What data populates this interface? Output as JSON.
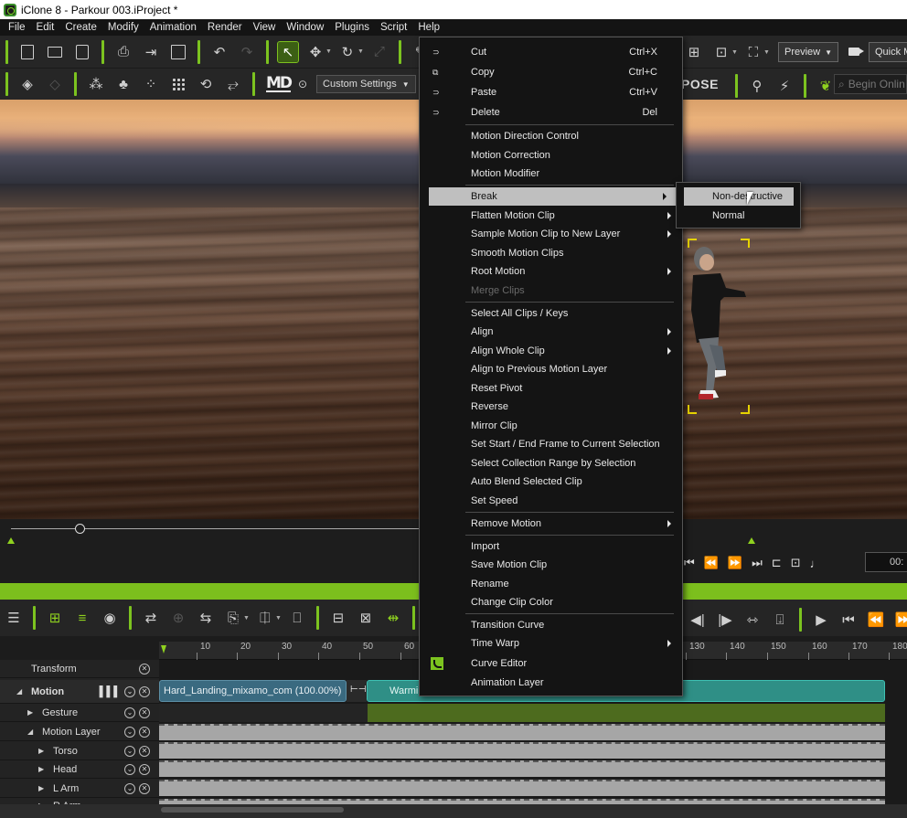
{
  "window": {
    "title": "iClone 8 - Parkour 003.iProject *"
  },
  "menubar": [
    "File",
    "Edit",
    "Create",
    "Modify",
    "Animation",
    "Render",
    "View",
    "Window",
    "Plugins",
    "Script",
    "Help"
  ],
  "toolbar": {
    "preview_label": "Preview",
    "quick_label": "Quick M",
    "custom_settings_label": "Custom Settings",
    "pose_label": "POSE",
    "search_placeholder": "Begin Onlin"
  },
  "context_menu": {
    "items": [
      {
        "label": "Cut",
        "shortcut": "Ctrl+X"
      },
      {
        "label": "Copy",
        "shortcut": "Ctrl+C"
      },
      {
        "label": "Paste",
        "shortcut": "Ctrl+V"
      },
      {
        "label": "Delete",
        "shortcut": "Del"
      },
      {
        "label": "Motion Direction Control"
      },
      {
        "label": "Motion Correction"
      },
      {
        "label": "Motion Modifier"
      },
      {
        "label": "Break"
      },
      {
        "label": "Flatten Motion Clip"
      },
      {
        "label": "Sample Motion Clip to New Layer"
      },
      {
        "label": "Smooth Motion Clips"
      },
      {
        "label": "Root Motion"
      },
      {
        "label": "Merge Clips"
      },
      {
        "label": "Select All Clips / Keys"
      },
      {
        "label": "Align"
      },
      {
        "label": "Align Whole Clip"
      },
      {
        "label": "Align to Previous Motion Layer"
      },
      {
        "label": "Reset Pivot"
      },
      {
        "label": "Reverse"
      },
      {
        "label": "Mirror Clip"
      },
      {
        "label": "Set Start / End Frame to Current Selection"
      },
      {
        "label": "Select Collection Range by Selection"
      },
      {
        "label": "Auto Blend Selected Clip"
      },
      {
        "label": "Set Speed"
      },
      {
        "label": "Remove Motion"
      },
      {
        "label": "Import"
      },
      {
        "label": "Save Motion Clip"
      },
      {
        "label": "Rename"
      },
      {
        "label": "Change Clip Color"
      },
      {
        "label": "Transition Curve"
      },
      {
        "label": "Time Warp"
      },
      {
        "label": "Curve Editor"
      },
      {
        "label": "Animation Layer"
      }
    ]
  },
  "submenu": {
    "items": [
      {
        "label": "Non-destructive"
      },
      {
        "label": "Normal"
      }
    ]
  },
  "timeline": {
    "ruler_ticks": [
      "10",
      "20",
      "30",
      "40",
      "50",
      "60",
      "130",
      "140",
      "150",
      "160",
      "170",
      "180"
    ],
    "tracks": {
      "transform": "Transform",
      "motion": "Motion",
      "gesture": "Gesture",
      "motion_layer": "Motion Layer",
      "torso": "Torso",
      "head": "Head",
      "l_arm": "L Arm",
      "r_arm": "R Arm"
    },
    "clips": {
      "clip_a": "Hard_Landing_mixamo_com (100.00%)",
      "clip_b": "Warmi"
    }
  },
  "colors": {
    "accent_green": "#7cbf1d",
    "menu_highlight": "#bfbfbf",
    "clip_teal": "#2f8f86",
    "clip_blue": "#3a6a80"
  }
}
